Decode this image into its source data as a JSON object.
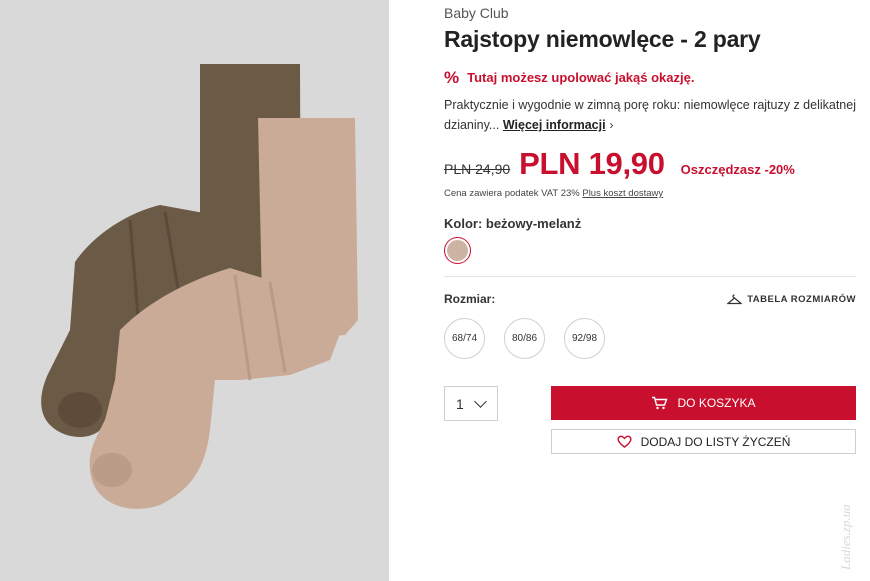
{
  "product_image": {
    "icon": "tights-product-photo"
  },
  "brand": "Baby Club",
  "title": "Rajstopy niemowlęce - 2 pary",
  "promo": {
    "icon": "percent-icon",
    "text": "Tutaj możesz upolować jakąś okazję."
  },
  "description": {
    "text": "Praktycznie i wygodnie w zimną porę roku: niemowlęce rajtuzy z delikatnej dzianiny...",
    "more_link": "Więcej informacji"
  },
  "price": {
    "old": "PLN 24,90",
    "current": "PLN 19,90",
    "saving": "Oszczędzasz -20%",
    "vat_note": "Cena zawiera podatek VAT 23%",
    "shipping_link": "Plus koszt dostawy"
  },
  "color": {
    "label": "Kolor: beżowy-melanż",
    "swatch_hex": "#cdb3a4"
  },
  "size": {
    "label": "Rozmiar:",
    "chart_link": "TABELA ROZMIARÓW",
    "options": [
      "68/74",
      "80/86",
      "92/98"
    ]
  },
  "quantity": {
    "value": "1"
  },
  "actions": {
    "add_to_cart": "DO KOSZYKA",
    "add_to_wishlist": "DODAJ DO LISTY ŻYCZEŃ"
  },
  "watermark": "Ladies.zp.ua",
  "colors": {
    "accent": "#c8102e",
    "panel_bg": "#d9d9d9",
    "brown": "#6b5a45",
    "beige": "#c9ab97"
  }
}
